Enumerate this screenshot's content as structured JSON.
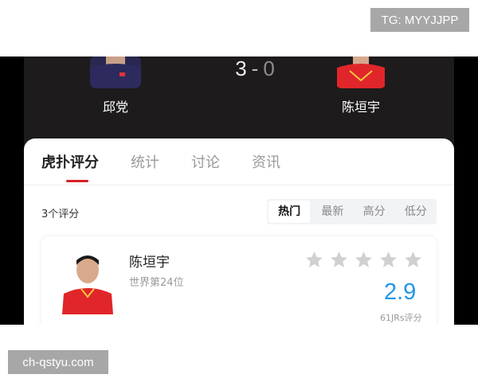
{
  "watermarks": {
    "top_right": "TG: MYYJJPP",
    "bottom_left": "ch-qstyu.com"
  },
  "match": {
    "home_player": "邱党",
    "away_player": "陈垣宇",
    "score_home": "3",
    "score_separator": "-",
    "score_away": "0"
  },
  "tabs": [
    {
      "label": "虎扑评分",
      "active": true
    },
    {
      "label": "统计",
      "active": false
    },
    {
      "label": "讨论",
      "active": false
    },
    {
      "label": "资讯",
      "active": false
    }
  ],
  "ratings": {
    "count_label": "3个评分",
    "sort_options": [
      "热门",
      "最新",
      "高分",
      "低分"
    ],
    "sort_selected": "热门"
  },
  "player_card": {
    "name": "陈垣宇",
    "subtitle": "世界第24位",
    "score": "2.9",
    "votes_label": "61JRs评分",
    "stars_filled": 0,
    "stars_total": 5
  },
  "colors": {
    "accent_red": "#d81f26",
    "score_blue": "#2196e8",
    "header_bg": "#1d1b1c",
    "star_empty": "#d0d0d0"
  },
  "icons": [
    "star-icon"
  ]
}
